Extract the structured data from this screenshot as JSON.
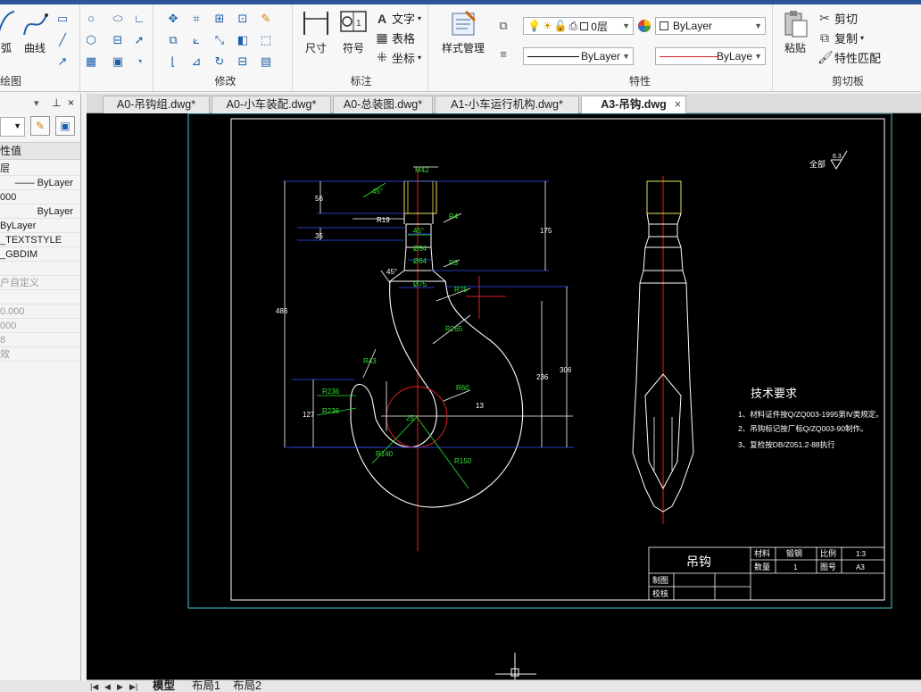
{
  "ribbon": {
    "draw": {
      "arc": "弧",
      "polyline": "曲线",
      "title": "绘图"
    },
    "modify": {
      "title": "修改"
    },
    "annotation": {
      "dimension": "尺寸",
      "symbol": "符号",
      "text": "文字",
      "table": "表格",
      "coord": "坐标",
      "title": "标注"
    },
    "style": {
      "style_manager": "样式管理"
    },
    "properties": {
      "layer": "0层",
      "color": "ByLayer",
      "linetype": "ByLayer",
      "lineweight": "ByLaye",
      "title": "特性"
    },
    "clipboard": {
      "paste": "粘贴",
      "cut": "剪切",
      "copy": "复制",
      "match": "特性匹配",
      "title": "剪切板"
    }
  },
  "doc_tabs": [
    {
      "label": "A0-吊钩组.dwg*"
    },
    {
      "label": "A0-小车装配.dwg*"
    },
    {
      "label": "A0-总装图.dwg*"
    },
    {
      "label": "A1-小车运行机构.dwg*"
    },
    {
      "label": "A3-吊钩.dwg",
      "active": true
    }
  ],
  "doc_tab_close": "×",
  "properties_panel": {
    "header": "性值",
    "rows": [
      {
        "value": "层",
        "gray": false
      },
      {
        "value": "—— ByLayer",
        "gray": false
      },
      {
        "value": "000",
        "gray": false
      },
      {
        "value": "ByLayer",
        "gray": false
      },
      {
        "value": "ByLayer",
        "gray": false
      },
      {
        "value": "_TEXTSTYLE",
        "gray": false
      },
      {
        "value": "_GBDIM",
        "gray": false
      },
      {
        "value": "",
        "gray": false
      },
      {
        "value": "户自定义",
        "gray": true
      },
      {
        "value": "",
        "gray": true
      },
      {
        "value": "0.000",
        "gray": true
      },
      {
        "value": "000",
        "gray": true
      },
      {
        "value": "8",
        "gray": true
      },
      {
        "value": "效",
        "gray": true
      }
    ]
  },
  "layout_tabs": [
    {
      "label": "模型",
      "active": true
    },
    {
      "label": "布局1"
    },
    {
      "label": "布局2"
    }
  ],
  "drawing": {
    "roughness": "全部",
    "roughness_value": "6.3",
    "tech_title": "技术要求",
    "tech_notes": [
      "1、材料证件按Q/ZQ003-1995第Ⅳ类规定。",
      "2、吊钩标记按厂标Q/ZQ003-90制作。",
      "3、复检按DB/Z051.2-88执行"
    ],
    "title_block": {
      "part_name": "吊钩",
      "material_label": "材料",
      "material": "锻钢",
      "scale_label": "比例",
      "scale": "1:3",
      "qty_label": "数量",
      "qty": "1",
      "drawing_no_label": "图号",
      "drawing_no": "A3",
      "drawn_label": "制图",
      "checked_label": "校核"
    },
    "dims": {
      "m": "M42",
      "r19": "R19",
      "a45a": "45°",
      "a45b": "45°",
      "a45c": "45°",
      "d54": "Ø54",
      "d64": "Ø64",
      "d75": "Ø75",
      "r4": "R4",
      "r3": "R3",
      "r75": "R75",
      "r265": "R265",
      "r43": "R43",
      "r236a": "R236",
      "r236b": "R236",
      "r140": "R140",
      "r60": "R60",
      "r150": "R150",
      "d25": "25",
      "v56": "56",
      "v35": "35",
      "v175": "175",
      "v486": "486",
      "v127": "127",
      "v236": "236",
      "v306": "306",
      "v13": "13"
    }
  }
}
